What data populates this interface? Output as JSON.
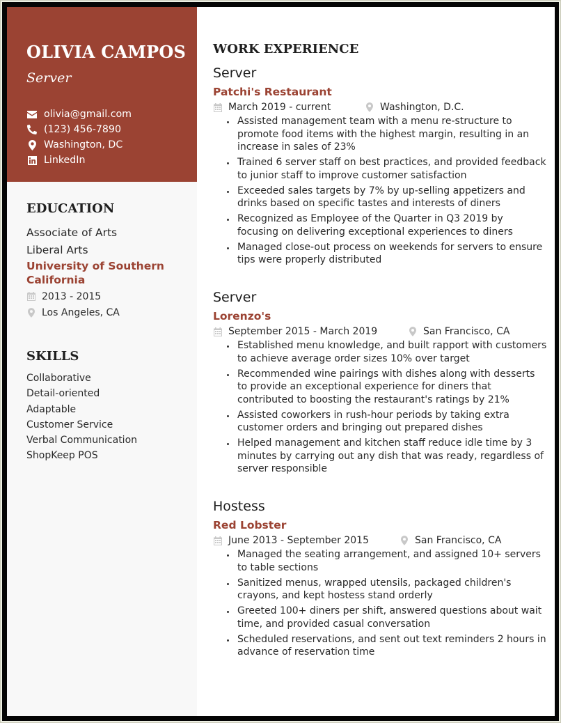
{
  "profile": {
    "name": "OLIVIA CAMPOS",
    "role": "Server",
    "contacts": [
      {
        "icon": "envelope-icon",
        "text": "olivia@gmail.com"
      },
      {
        "icon": "phone-icon",
        "text": "(123) 456-7890"
      },
      {
        "icon": "map-marker-icon",
        "text": "Washington, DC"
      },
      {
        "icon": "linkedin-icon",
        "text": "LinkedIn"
      }
    ]
  },
  "education": {
    "title": "EDUCATION",
    "degree": "Associate of Arts",
    "field": "Liberal Arts",
    "school": "University of Southern California",
    "dates": "2013 - 2015",
    "location": "Los Angeles, CA"
  },
  "skills": {
    "title": "SKILLS",
    "items": [
      "Collaborative",
      "Detail-oriented",
      "Adaptable",
      "Customer Service",
      "Verbal Communication",
      "ShopKeep POS"
    ]
  },
  "work": {
    "title": "WORK EXPERIENCE",
    "jobs": [
      {
        "title": "Server",
        "company": "Patchi's Restaurant",
        "dates": "March 2019 - current",
        "location": "Washington, D.C.",
        "bullets": [
          "Assisted management team with a menu re-structure to promote food items with the highest margin, resulting in an increase in sales of 23%",
          "Trained 6 server staff on best practices, and provided feedback to junior staff to improve customer satisfaction",
          "Exceeded sales targets by 7% by up-selling appetizers and drinks based on specific tastes and interests of diners",
          "Recognized as Employee of the Quarter in Q3 2019 by focusing on delivering exceptional experiences to diners",
          "Managed close-out process on weekends for servers to ensure tips were properly distributed"
        ]
      },
      {
        "title": "Server",
        "company": "Lorenzo's",
        "dates": "September 2015 - March 2019",
        "location": "San Francisco, CA",
        "bullets": [
          "Established menu knowledge, and built rapport with customers to achieve average order sizes 10% over target",
          "Recommended wine pairings with dishes along with desserts to provide an exceptional experience for diners that contributed to boosting the restaurant's ratings by 21%",
          "Assisted coworkers in rush-hour periods by taking extra customer orders and bringing out prepared dishes",
          "Helped management and kitchen staff reduce idle time by 3 minutes by carrying out any dish that was ready, regardless of server responsible"
        ]
      },
      {
        "title": "Hostess",
        "company": "Red Lobster",
        "dates": "June 2013 - September 2015",
        "location": "San Francisco, CA",
        "bullets": [
          "Managed the seating arrangement, and assigned 10+ servers to table sections",
          "Sanitized menus, wrapped utensils, packaged children's crayons, and kept hostess stand orderly",
          "Greeted 100+ diners per shift, answered questions about wait time, and provided casual conversation",
          "Scheduled reservations, and sent out text reminders 2 hours in advance of reservation time"
        ]
      }
    ]
  },
  "colors": {
    "accent": "#9b4333",
    "sidebar_bg": "#f8f8f8",
    "text": "#2a2a2a",
    "icon_gray": "#c8c8c8"
  }
}
